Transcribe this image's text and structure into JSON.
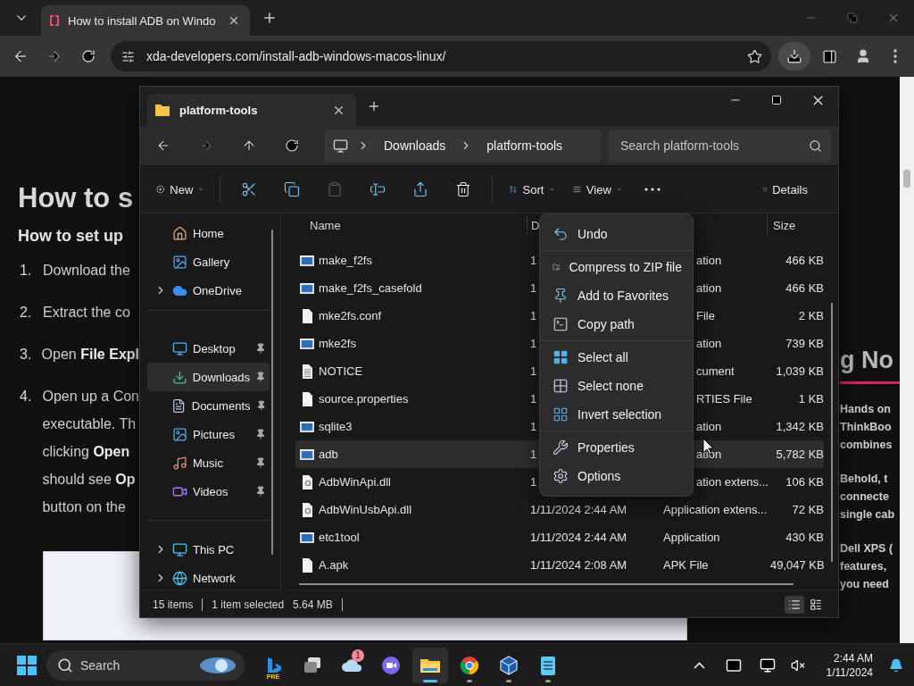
{
  "browser": {
    "tab": {
      "title": "How to install ADB on Windo"
    },
    "address": "xda-developers.com/install-adb-windows-macos-linux/"
  },
  "page": {
    "heading": "How to s",
    "subheading": "How to set up",
    "steps": [
      {
        "number": "1.",
        "lines": [
          "Download the"
        ]
      },
      {
        "number": "2.",
        "lines": [
          "Extract the co"
        ]
      },
      {
        "number": "3.",
        "lines": [
          "Open **File Expl**"
        ]
      },
      {
        "number": "4.",
        "lines": [
          "Open up a Con",
          "executable. Th",
          "clicking **Open**",
          "should see **Op**",
          "button on the"
        ]
      }
    ],
    "side_heading": "g No",
    "side_paragraphs": [
      [
        "Hands on",
        "ThinkBoo",
        "combines"
      ],
      [
        "Behold, t",
        "connecte",
        "single cab"
      ],
      [
        "Dell XPS (",
        "features,",
        "you need"
      ]
    ]
  },
  "explorer": {
    "tab": "platform-tools",
    "breadcrumbs": [
      "Downloads",
      "platform-tools"
    ],
    "search": {
      "placeholder": "Search platform-tools"
    },
    "toolbar": [
      {
        "kind": "new",
        "label": "New",
        "disabled": false
      },
      {
        "kind": "cut",
        "disabled": false
      },
      {
        "kind": "copy",
        "disabled": false
      },
      {
        "kind": "paste",
        "disabled": true
      },
      {
        "kind": "rename",
        "disabled": false
      },
      {
        "kind": "share",
        "disabled": false
      },
      {
        "kind": "delete",
        "disabled": false
      },
      {
        "kind": "sort",
        "label": "Sort",
        "disabled": false
      },
      {
        "kind": "view",
        "label": "View",
        "disabled": false
      },
      {
        "kind": "more",
        "disabled": false
      },
      {
        "kind": "details",
        "label": "Details",
        "disabled": false
      }
    ],
    "sidebar": [
      [
        {
          "kind": "home",
          "label": "Home",
          "selected": false,
          "pinned": false,
          "expandable": false
        },
        {
          "kind": "gallery",
          "label": "Gallery",
          "selected": false,
          "pinned": false,
          "expandable": false
        },
        {
          "kind": "onedrive",
          "label": "OneDrive",
          "selected": false,
          "pinned": false,
          "expandable": true
        }
      ],
      [
        {
          "kind": "desktop",
          "label": "Desktop",
          "selected": false,
          "pinned": true,
          "expandable": false
        },
        {
          "kind": "downloads",
          "label": "Downloads",
          "selected": true,
          "pinned": true,
          "expandable": false
        },
        {
          "kind": "documents",
          "label": "Documents",
          "selected": false,
          "pinned": true,
          "expandable": false
        },
        {
          "kind": "pictures",
          "label": "Pictures",
          "selected": false,
          "pinned": true,
          "expandable": false
        },
        {
          "kind": "music",
          "label": "Music",
          "selected": false,
          "pinned": true,
          "expandable": false
        },
        {
          "kind": "videos",
          "label": "Videos",
          "selected": false,
          "pinned": true,
          "expandable": false
        }
      ],
      [
        {
          "kind": "thispc",
          "label": "This PC",
          "selected": false,
          "pinned": false,
          "expandable": true
        },
        {
          "kind": "network",
          "label": "Network",
          "selected": false,
          "pinned": false,
          "expandable": true
        }
      ]
    ],
    "columns": {
      "name": "Name",
      "date": "D",
      "size": "Size"
    },
    "rows": [
      {
        "kind": "app",
        "name": "make_f2fs",
        "date": "1",
        "type": "ation",
        "size": "466 KB",
        "selected": false
      },
      {
        "kind": "app",
        "name": "make_f2fs_casefold",
        "date": "1",
        "type": "ation",
        "size": "466 KB",
        "selected": false
      },
      {
        "kind": "file",
        "name": "mke2fs.conf",
        "date": "1",
        "type": "File",
        "size": "2 KB",
        "selected": false
      },
      {
        "kind": "app",
        "name": "mke2fs",
        "date": "1",
        "type": "ation",
        "size": "739 KB",
        "selected": false
      },
      {
        "kind": "doc",
        "name": "NOTICE",
        "date": "1",
        "type": "cument",
        "size": "1,039 KB",
        "selected": false
      },
      {
        "kind": "file",
        "name": "source.properties",
        "date": "1",
        "type": "RTIES File",
        "size": "1 KB",
        "selected": false
      },
      {
        "kind": "app",
        "name": "sqlite3",
        "date": "1",
        "type": "ation",
        "size": "1,342 KB",
        "selected": false
      },
      {
        "kind": "app",
        "name": "adb",
        "date": "1",
        "type": "ation",
        "size": "5,782 KB",
        "selected": true
      },
      {
        "kind": "dll",
        "name": "AdbWinApi.dll",
        "date": "1",
        "type": "ation extens...",
        "size": "106 KB",
        "selected": false
      },
      {
        "kind": "dll",
        "name": "AdbWinUsbApi.dll",
        "date": "1/11/2024 2:44 AM",
        "type": "Application extens...",
        "size": "72 KB",
        "selected": false
      },
      {
        "kind": "app",
        "name": "etc1tool",
        "date": "1/11/2024 2:44 AM",
        "type": "Application",
        "size": "430 KB",
        "selected": false
      },
      {
        "kind": "file",
        "name": "A.apk",
        "date": "1/11/2024 2:08 AM",
        "type": "APK File",
        "size": "49,047 KB",
        "selected": false
      }
    ],
    "status": {
      "count": "15 items",
      "selection": "1 item selected",
      "size": "5.64 MB"
    },
    "context_menu": [
      [
        {
          "kind": "undo",
          "label": "Undo"
        }
      ],
      [
        {
          "kind": "zip",
          "label": "Compress to ZIP file"
        },
        {
          "kind": "pin",
          "label": "Add to Favorites"
        },
        {
          "kind": "path",
          "label": "Copy path"
        }
      ],
      [
        {
          "kind": "select-all",
          "label": "Select all"
        },
        {
          "kind": "select-none",
          "label": "Select none"
        },
        {
          "kind": "invert",
          "label": "Invert selection"
        }
      ],
      [
        {
          "kind": "properties",
          "label": "Properties"
        },
        {
          "kind": "options",
          "label": "Options"
        }
      ]
    ]
  },
  "taskbar": {
    "search": {
      "placeholder": "Search"
    },
    "apps": [
      {
        "kind": "copilot",
        "badge": "PRE",
        "active": false,
        "running": false
      },
      {
        "kind": "taskview",
        "active": false,
        "running": false
      },
      {
        "kind": "weather",
        "count": "1",
        "active": false,
        "running": false
      },
      {
        "kind": "meet",
        "active": false,
        "running": false
      },
      {
        "kind": "explorer",
        "active": true,
        "running": true
      },
      {
        "kind": "chrome",
        "active": false,
        "running": true
      },
      {
        "kind": "virtualbox",
        "active": false,
        "running": true
      },
      {
        "kind": "notepad",
        "active": false,
        "running": true
      }
    ],
    "time": "2:44 AM",
    "date": "1/11/2024"
  }
}
